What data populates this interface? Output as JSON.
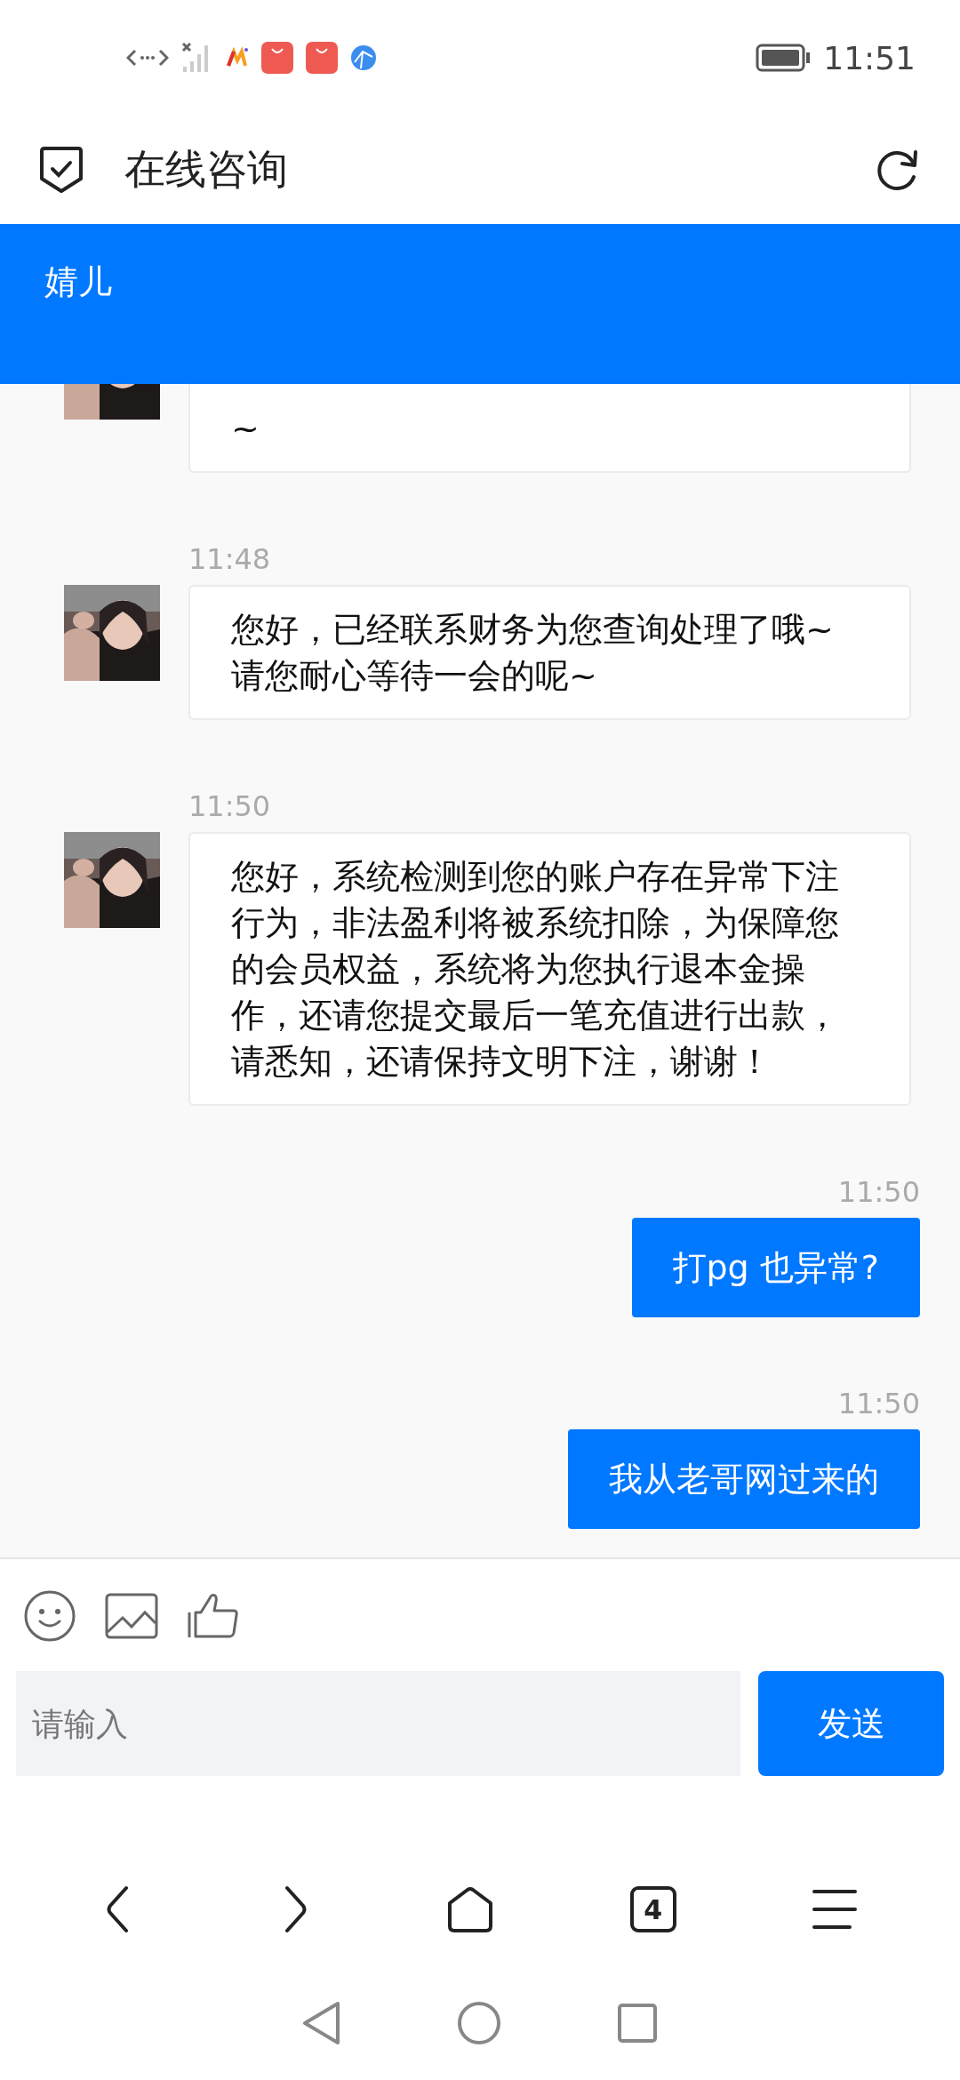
{
  "status_bar": {
    "time": "11:51"
  },
  "header": {
    "title": "在线咨询"
  },
  "agent": {
    "name": "婧儿"
  },
  "messages": [
    {
      "kind": "agent",
      "text": "~"
    },
    {
      "kind": "agent",
      "time": "11:48",
      "text": "您好，已经联系财务为您查询处理了哦~\n请您耐心等待一会的呢~"
    },
    {
      "kind": "agent",
      "time": "11:50",
      "text": "您好，系统检测到您的账户存在异常下注行为，非法盈利将被系统扣除，为保障您的会员权益，系统将为您执行退本金操作，还请您提交最后一笔充值进行出款，请悉知，还请保持文明下注，谢谢！"
    },
    {
      "kind": "user",
      "time": "11:50",
      "text": "打pg 也异常?"
    },
    {
      "kind": "user",
      "time": "11:50",
      "text": "我从老哥网过来的"
    }
  ],
  "composer": {
    "placeholder": "请输入",
    "send": "发送"
  },
  "browser_bar": {
    "tab_count": "4"
  }
}
